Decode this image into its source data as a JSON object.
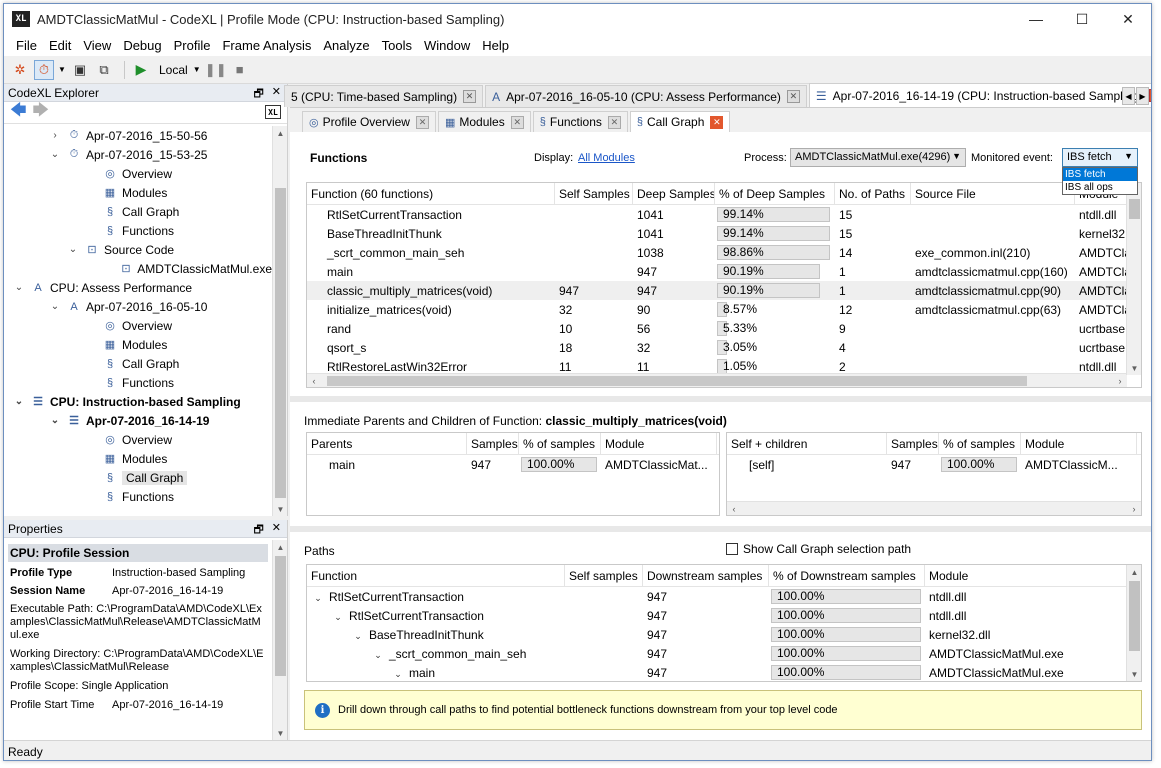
{
  "window": {
    "title": "AMDTClassicMatMul - CodeXL | Profile Mode (CPU: Instruction-based Sampling)",
    "app_icon": "XL",
    "min": "—",
    "max": "☐",
    "close": "✕"
  },
  "menu": [
    "File",
    "Edit",
    "View",
    "Debug",
    "Profile",
    "Frame Analysis",
    "Analyze",
    "Tools",
    "Window",
    "Help"
  ],
  "toolbar": {
    "local_label": "Local"
  },
  "explorer": {
    "title": "CodeXL Explorer",
    "tree": [
      {
        "label": "Apr-07-2016_15-50-56",
        "indent": 3,
        "exp": "›",
        "icon": "timer-icon"
      },
      {
        "label": "Apr-07-2016_15-53-25",
        "indent": 3,
        "exp": "⌄",
        "icon": "timer-icon"
      },
      {
        "label": "Overview",
        "indent": 5,
        "icon": "overview-icon"
      },
      {
        "label": "Modules",
        "indent": 5,
        "icon": "modules-icon"
      },
      {
        "label": "Call Graph",
        "indent": 5,
        "icon": "callgraph-icon"
      },
      {
        "label": "Functions",
        "indent": 5,
        "icon": "functions-icon"
      },
      {
        "label": "Source Code",
        "indent": 4,
        "exp": "⌄",
        "icon": "source-icon"
      },
      {
        "label": "AMDTClassicMatMul.exe",
        "indent": 6,
        "icon": "source-file-icon"
      },
      {
        "label": "CPU: Assess Performance",
        "indent": 1,
        "exp": "⌄",
        "icon": "assess-icon"
      },
      {
        "label": "Apr-07-2016_16-05-10",
        "indent": 3,
        "exp": "⌄",
        "icon": "assess-icon"
      },
      {
        "label": "Overview",
        "indent": 5,
        "icon": "overview-icon"
      },
      {
        "label": "Modules",
        "indent": 5,
        "icon": "modules-icon"
      },
      {
        "label": "Call Graph",
        "indent": 5,
        "icon": "callgraph-icon"
      },
      {
        "label": "Functions",
        "indent": 5,
        "icon": "functions-icon"
      },
      {
        "label": "CPU: Instruction-based Sampling",
        "indent": 1,
        "exp": "⌄",
        "icon": "ibs-icon",
        "bold": true
      },
      {
        "label": "Apr-07-2016_16-14-19",
        "indent": 3,
        "exp": "⌄",
        "icon": "ibs-icon",
        "bold": true
      },
      {
        "label": "Overview",
        "indent": 5,
        "icon": "overview-icon"
      },
      {
        "label": "Modules",
        "indent": 5,
        "icon": "modules-icon"
      },
      {
        "label": "Call Graph",
        "indent": 5,
        "icon": "callgraph-icon",
        "selected": true
      },
      {
        "label": "Functions",
        "indent": 5,
        "icon": "functions-icon"
      }
    ]
  },
  "properties": {
    "title": "Properties",
    "section": "CPU: Profile Session",
    "profile_type_k": "Profile Type",
    "profile_type_v": "Instruction-based Sampling",
    "session_name_k": "Session Name",
    "session_name_v": "Apr-07-2016_16-14-19",
    "exec_path": "Executable Path: C:\\ProgramData\\AMD\\CodeXL\\Examples\\ClassicMatMul\\Release\\AMDTClassicMatMul.exe",
    "working_dir": "Working Directory: C:\\ProgramData\\AMD\\CodeXL\\Examples\\ClassicMatMul\\Release",
    "scope": "Profile Scope: Single Application",
    "start_k": "Profile Start Time",
    "start_v": "Apr-07-2016_16-14-19"
  },
  "status": "Ready",
  "doc_tabs": [
    {
      "label": "5 (CPU: Time-based Sampling)",
      "active": false
    },
    {
      "label": "Apr-07-2016_16-05-10 (CPU: Assess Performance)",
      "active": false
    },
    {
      "label": "Apr-07-2016_16-14-19 (CPU: Instruction-based Sampling)",
      "active": true
    }
  ],
  "sub_tabs": [
    {
      "label": "Profile Overview",
      "active": false
    },
    {
      "label": "Modules",
      "active": false
    },
    {
      "label": "Functions",
      "active": false
    },
    {
      "label": "Call Graph",
      "active": true
    }
  ],
  "functions_panel": {
    "title": "Functions",
    "display_label": "Display:",
    "display_link": "All Modules",
    "process_label": "Process:",
    "process_value": "AMDTClassicMatMul.exe(4296)",
    "monitor_label": "Monitored event:",
    "monitor_value": "IBS fetch",
    "monitor_options": [
      "IBS fetch",
      "IBS all ops"
    ],
    "columns": [
      "Function (60 functions)",
      "Self Samples",
      "Deep Samples",
      "% of Deep Samples",
      "No. of Paths",
      "Source File",
      "Module"
    ],
    "rows": [
      {
        "fn": "RtlSetCurrentTransaction",
        "self": "",
        "deep": "1041",
        "pct": "99.14%",
        "pv": 99.14,
        "paths": "15",
        "src": "",
        "mod": "ntdll.dll"
      },
      {
        "fn": "BaseThreadInitThunk",
        "self": "",
        "deep": "1041",
        "pct": "99.14%",
        "pv": 99.14,
        "paths": "15",
        "src": "",
        "mod": "kernel32.dll"
      },
      {
        "fn": "_scrt_common_main_seh",
        "self": "",
        "deep": "1038",
        "pct": "98.86%",
        "pv": 98.86,
        "paths": "14",
        "src": "exe_common.inl(210)",
        "mod": "AMDTClassicMatMul.exe"
      },
      {
        "fn": "main",
        "self": "",
        "deep": "947",
        "pct": "90.19%",
        "pv": 90.19,
        "paths": "1",
        "src": "amdtclassicmatmul.cpp(160)",
        "mod": "AMDTClassicMatMul.exe"
      },
      {
        "fn": "classic_multiply_matrices(void)",
        "self": "947",
        "deep": "947",
        "pct": "90.19%",
        "pv": 90.19,
        "paths": "1",
        "src": "amdtclassicmatmul.cpp(90)",
        "mod": "AMDTClassicMatMul.exe",
        "sel": true
      },
      {
        "fn": "initialize_matrices(void)",
        "self": "32",
        "deep": "90",
        "pct": "8.57%",
        "pv": 8.57,
        "paths": "12",
        "src": "amdtclassicmatmul.cpp(63)",
        "mod": "AMDTClassicMatMul.exe"
      },
      {
        "fn": "rand",
        "self": "10",
        "deep": "56",
        "pct": "5.33%",
        "pv": 5.33,
        "paths": "9",
        "src": "",
        "mod": "ucrtbase.dll"
      },
      {
        "fn": "qsort_s",
        "self": "18",
        "deep": "32",
        "pct": "3.05%",
        "pv": 3.05,
        "paths": "4",
        "src": "",
        "mod": "ucrtbase.dll"
      },
      {
        "fn": "RtlRestoreLastWin32Error",
        "self": "11",
        "deep": "11",
        "pct": "1.05%",
        "pv": 1.05,
        "paths": "2",
        "src": "",
        "mod": "ntdll.dll"
      }
    ]
  },
  "immediate": {
    "title_prefix": "Immediate Parents and Children of Function:",
    "title_fn": "classic_multiply_matrices(void)",
    "parents_cols": [
      "Parents",
      "Samples",
      "% of samples",
      "Module"
    ],
    "parents_rows": [
      {
        "name": "main",
        "samples": "947",
        "pct": "100.00%",
        "module": "AMDTClassicMat..."
      }
    ],
    "children_cols": [
      "Self + children",
      "Samples",
      "% of samples",
      "Module"
    ],
    "children_rows": [
      {
        "name": "[self]",
        "samples": "947",
        "pct": "100.00%",
        "module": "AMDTClassicM..."
      }
    ]
  },
  "paths": {
    "title": "Paths",
    "checkbox_label": "Show Call Graph selection path",
    "columns": [
      "Function",
      "Self samples",
      "Downstream samples",
      "% of Downstream samples",
      "Module"
    ],
    "rows": [
      {
        "fn": "RtlSetCurrentTransaction",
        "level": 0,
        "down": "947",
        "pct": "100.00%",
        "module": "ntdll.dll"
      },
      {
        "fn": "RtlSetCurrentTransaction",
        "level": 1,
        "down": "947",
        "pct": "100.00%",
        "module": "ntdll.dll"
      },
      {
        "fn": "BaseThreadInitThunk",
        "level": 2,
        "down": "947",
        "pct": "100.00%",
        "module": "kernel32.dll"
      },
      {
        "fn": "_scrt_common_main_seh",
        "level": 3,
        "down": "947",
        "pct": "100.00%",
        "module": "AMDTClassicMatMul.exe"
      },
      {
        "fn": "main",
        "level": 4,
        "down": "947",
        "pct": "100.00%",
        "module": "AMDTClassicMatMul.exe"
      }
    ]
  },
  "info": {
    "icon": "i",
    "text": "Drill down through call paths to find potential bottleneck functions downstream from your top level code"
  }
}
